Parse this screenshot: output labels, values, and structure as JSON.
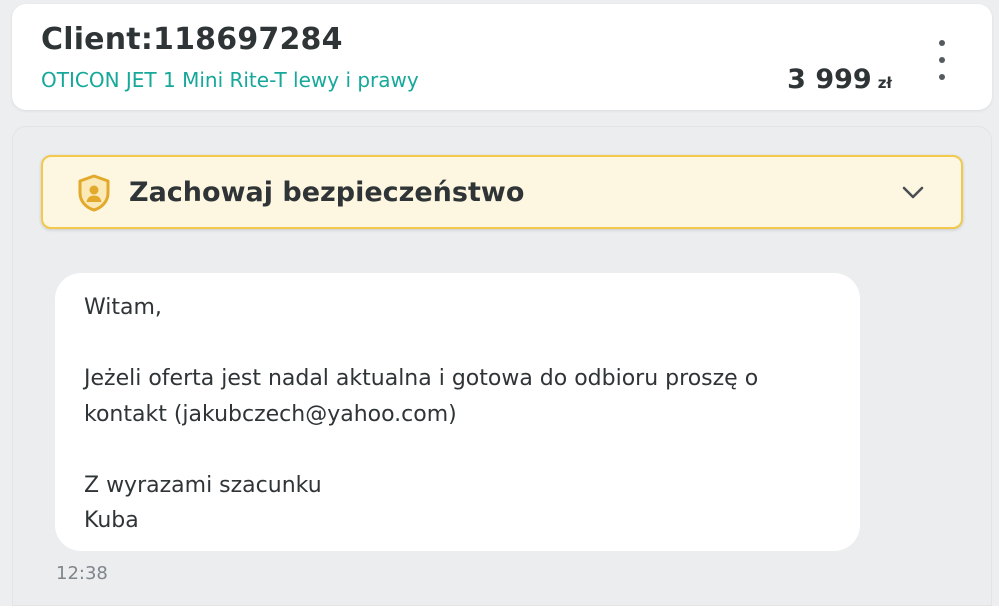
{
  "header": {
    "client_title": "Client:118697284",
    "product_name": "OTICON JET 1 Mini Rite-T lewy i prawy",
    "price_amount": "3 999",
    "price_currency": "zł",
    "menu_icon": "kebab-menu-icon"
  },
  "safety_banner": {
    "title": "Zachowaj bezpieczeństwo",
    "icon": "shield-user-icon",
    "expand_icon": "chevron-down-icon",
    "accent_color": "#f2c94c",
    "background_color": "#fdf6e1"
  },
  "message": {
    "text": "Witam,\n\nJeżeli oferta jest nadal aktualna i gotowa do odbioru proszę o kontakt (jakubczech@yahoo.com)\n\nZ wyrazami szacunku\nKuba",
    "time": "12:38"
  },
  "colors": {
    "product_link": "#16a89b",
    "text_primary": "#2f3437",
    "text_muted": "#7f858a"
  }
}
